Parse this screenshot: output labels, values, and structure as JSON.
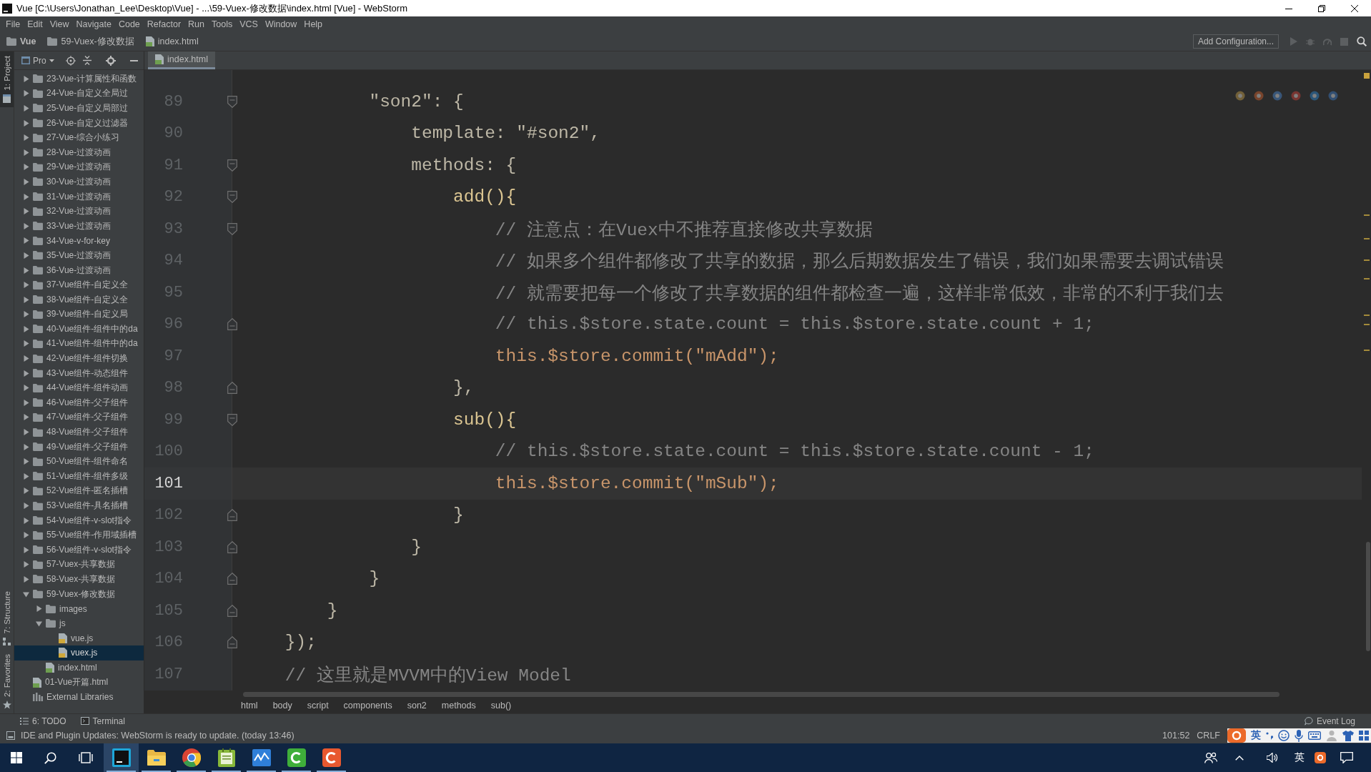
{
  "window": {
    "title": "Vue [C:\\Users\\Jonathan_Lee\\Desktop\\Vue] - ...\\59-Vuex-修改数据\\index.html [Vue] - WebStorm"
  },
  "menu": [
    "File",
    "Edit",
    "View",
    "Navigate",
    "Code",
    "Refactor",
    "Run",
    "Tools",
    "VCS",
    "Window",
    "Help"
  ],
  "navbar": {
    "breadcrumbs": [
      {
        "label": "Vue",
        "kind": "project"
      },
      {
        "label": "59-Vuex-修改数据",
        "kind": "folder"
      },
      {
        "label": "index.html",
        "kind": "html"
      }
    ],
    "run_configuration": "Add Configuration..."
  },
  "tool_strip": {
    "top": [
      {
        "label": "1: Project",
        "kind": "project",
        "selected": true
      }
    ],
    "bottom": [
      {
        "label": "7: Structure",
        "kind": "structure",
        "selected": false
      },
      {
        "label": "2: Favorites",
        "kind": "favorites",
        "selected": false
      }
    ]
  },
  "project_panel": {
    "title": "Pro",
    "tree": [
      {
        "label": "23-Vue-计算属性和函数",
        "kind": "folder",
        "expanded": false,
        "selected": false
      },
      {
        "label": "24-Vue-自定义全局过",
        "kind": "folder",
        "expanded": false,
        "selected": false
      },
      {
        "label": "25-Vue-自定义局部过",
        "kind": "folder",
        "expanded": false,
        "selected": false
      },
      {
        "label": "26-Vue-自定义过滤器",
        "kind": "folder",
        "expanded": false,
        "selected": false
      },
      {
        "label": "27-Vue-综合小练习",
        "kind": "folder",
        "expanded": false,
        "selected": false
      },
      {
        "label": "28-Vue-过渡动画",
        "kind": "folder",
        "expanded": false,
        "selected": false
      },
      {
        "label": "29-Vue-过渡动画",
        "kind": "folder",
        "expanded": false,
        "selected": false
      },
      {
        "label": "30-Vue-过渡动画",
        "kind": "folder",
        "expanded": false,
        "selected": false
      },
      {
        "label": "31-Vue-过渡动画",
        "kind": "folder",
        "expanded": false,
        "selected": false
      },
      {
        "label": "32-Vue-过渡动画",
        "kind": "folder",
        "expanded": false,
        "selected": false
      },
      {
        "label": "33-Vue-过渡动画",
        "kind": "folder",
        "expanded": false,
        "selected": false
      },
      {
        "label": "34-Vue-v-for-key",
        "kind": "folder",
        "expanded": false,
        "selected": false
      },
      {
        "label": "35-Vue-过渡动画",
        "kind": "folder",
        "expanded": false,
        "selected": false
      },
      {
        "label": "36-Vue-过渡动画",
        "kind": "folder",
        "expanded": false,
        "selected": false
      },
      {
        "label": "37-Vue组件-自定义全",
        "kind": "folder",
        "expanded": false,
        "selected": false
      },
      {
        "label": "38-Vue组件-自定义全",
        "kind": "folder",
        "expanded": false,
        "selected": false
      },
      {
        "label": "39-Vue组件-自定义局",
        "kind": "folder",
        "expanded": false,
        "selected": false
      },
      {
        "label": "40-Vue组件-组件中的da",
        "kind": "folder",
        "expanded": false,
        "selected": false
      },
      {
        "label": "41-Vue组件-组件中的da",
        "kind": "folder",
        "expanded": false,
        "selected": false
      },
      {
        "label": "42-Vue组件-组件切换",
        "kind": "folder",
        "expanded": false,
        "selected": false
      },
      {
        "label": "43-Vue组件-动态组件",
        "kind": "folder",
        "expanded": false,
        "selected": false
      },
      {
        "label": "44-Vue组件-组件动画",
        "kind": "folder",
        "expanded": false,
        "selected": false
      },
      {
        "label": "46-Vue组件-父子组件",
        "kind": "folder",
        "expanded": false,
        "selected": false
      },
      {
        "label": "47-Vue组件-父子组件",
        "kind": "folder",
        "expanded": false,
        "selected": false
      },
      {
        "label": "48-Vue组件-父子组件",
        "kind": "folder",
        "expanded": false,
        "selected": false
      },
      {
        "label": "49-Vue组件-父子组件",
        "kind": "folder",
        "expanded": false,
        "selected": false
      },
      {
        "label": "50-Vue组件-组件命名",
        "kind": "folder",
        "expanded": false,
        "selected": false
      },
      {
        "label": "51-Vue组件-组件多级",
        "kind": "folder",
        "expanded": false,
        "selected": false
      },
      {
        "label": "52-Vue组件-匿名插槽",
        "kind": "folder",
        "expanded": false,
        "selected": false
      },
      {
        "label": "53-Vue组件-具名插槽",
        "kind": "folder",
        "expanded": false,
        "selected": false
      },
      {
        "label": "54-Vue组件-v-slot指令",
        "kind": "folder",
        "expanded": false,
        "selected": false
      },
      {
        "label": "55-Vue组件-作用域插槽",
        "kind": "folder",
        "expanded": false,
        "selected": false
      },
      {
        "label": "56-Vue组件-v-slot指令",
        "kind": "folder",
        "expanded": false,
        "selected": false
      },
      {
        "label": "57-Vuex-共享数据",
        "kind": "folder",
        "expanded": false,
        "selected": false
      },
      {
        "label": "58-Vuex-共享数据",
        "kind": "folder",
        "expanded": false,
        "selected": false
      },
      {
        "label": "59-Vuex-修改数据",
        "kind": "folder",
        "expanded": true,
        "selected": false,
        "children": [
          {
            "label": "images",
            "kind": "folder",
            "expanded": false,
            "selected": false
          },
          {
            "label": "js",
            "kind": "folder",
            "expanded": true,
            "selected": false,
            "children": [
              {
                "label": "vue.js",
                "kind": "js",
                "selected": false
              },
              {
                "label": "vuex.js",
                "kind": "js",
                "selected": true
              }
            ]
          },
          {
            "label": "index.html",
            "kind": "html",
            "selected": false
          }
        ]
      },
      {
        "label": "01-Vue开篇.html",
        "kind": "html",
        "selected": false
      },
      {
        "label": "External Libraries",
        "kind": "library",
        "selected": false
      }
    ]
  },
  "editor": {
    "tabs": [
      {
        "label": "index.html",
        "selected": true
      }
    ],
    "lines": [
      {
        "number": "89",
        "text": "            \"son2\": {",
        "kind": "code",
        "fold_start": true,
        "fold_end": false,
        "current": false
      },
      {
        "number": "90",
        "text": "                template: \"#son2\",",
        "kind": "code",
        "fold_start": false,
        "fold_end": false,
        "current": false
      },
      {
        "number": "91",
        "text": "                methods: {",
        "kind": "code",
        "fold_start": true,
        "fold_end": false,
        "current": false
      },
      {
        "number": "92",
        "text": "                    add(){",
        "kind": "function",
        "fold_start": true,
        "fold_end": false,
        "current": false
      },
      {
        "number": "93",
        "text": "                        // 注意点：在Vuex中不推荐直接修改共享数据",
        "kind": "comment",
        "fold_start": true,
        "fold_end": false,
        "current": false
      },
      {
        "number": "94",
        "text": "                        // 如果多个组件都修改了共享的数据，那么后期数据发生了错误，我们如果需要去调试错误",
        "kind": "comment",
        "fold_start": false,
        "fold_end": false,
        "current": false
      },
      {
        "number": "95",
        "text": "                        // 就需要把每一个修改了共享数据的组件都检查一遍，这样非常低效，非常的不利于我们去",
        "kind": "comment",
        "fold_start": false,
        "fold_end": false,
        "current": false
      },
      {
        "number": "96",
        "text": "                        // this.$store.state.count = this.$store.state.count + 1;",
        "kind": "comment",
        "fold_start": false,
        "fold_end": true,
        "current": false
      },
      {
        "number": "97",
        "text": "                        this.$store.commit(\"mAdd\");",
        "kind": "call",
        "fold_start": false,
        "fold_end": false,
        "current": false
      },
      {
        "number": "98",
        "text": "                    },",
        "kind": "code",
        "fold_start": false,
        "fold_end": true,
        "current": false
      },
      {
        "number": "99",
        "text": "                    sub(){",
        "kind": "function",
        "fold_start": true,
        "fold_end": false,
        "current": false
      },
      {
        "number": "100",
        "text": "                        // this.$store.state.count = this.$store.state.count - 1;",
        "kind": "comment",
        "fold_start": false,
        "fold_end": false,
        "current": false
      },
      {
        "number": "101",
        "text": "                        this.$store.commit(\"mSub\");",
        "kind": "call",
        "fold_start": false,
        "fold_end": false,
        "current": true
      },
      {
        "number": "102",
        "text": "                    }",
        "kind": "code",
        "fold_start": false,
        "fold_end": true,
        "current": false
      },
      {
        "number": "103",
        "text": "                }",
        "kind": "code",
        "fold_start": false,
        "fold_end": true,
        "current": false
      },
      {
        "number": "104",
        "text": "            }",
        "kind": "code",
        "fold_start": false,
        "fold_end": true,
        "current": false
      },
      {
        "number": "105",
        "text": "        }",
        "kind": "code",
        "fold_start": false,
        "fold_end": true,
        "current": false
      },
      {
        "number": "106",
        "text": "    });",
        "kind": "code",
        "fold_start": false,
        "fold_end": true,
        "current": false
      },
      {
        "number": "107",
        "text": "    // 这里就是MVVM中的View Model",
        "kind": "comment",
        "fold_start": false,
        "fold_end": false,
        "current": false
      }
    ],
    "breadcrumbs": [
      "html",
      "body",
      "script",
      "components",
      "son2",
      "methods",
      "sub()"
    ]
  },
  "tool_windows": {
    "left": [
      {
        "label": "6: TODO",
        "kind": "todo"
      },
      {
        "label": "Terminal",
        "kind": "terminal"
      }
    ],
    "right": [
      {
        "label": "Event Log",
        "kind": "log"
      }
    ]
  },
  "status_bar": {
    "message": "IDE and Plugin Updates: WebStorm is ready to update. (today 13:46)",
    "position": "101:52",
    "line_separator": "CRLF",
    "input_mode": "英"
  },
  "taskbar": {
    "apps": [
      {
        "kind": "ide",
        "active": true
      },
      {
        "kind": "explorer",
        "active": false
      },
      {
        "kind": "browser",
        "active": false
      },
      {
        "kind": "notepad",
        "active": false
      },
      {
        "kind": "chart",
        "active": false
      },
      {
        "kind": "recorder",
        "active": false
      },
      {
        "kind": "video-editor",
        "active": false
      }
    ],
    "input_language": "英"
  }
}
